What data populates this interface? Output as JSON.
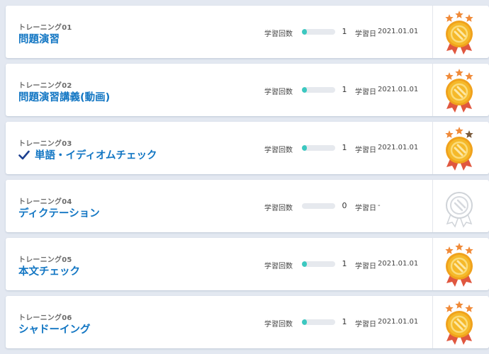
{
  "trainings": [
    {
      "label": "トレーニング01",
      "title": "問題演習",
      "checked": false,
      "count_label": "学習回数",
      "progress": 0.15,
      "count": "1",
      "date_label": "学習日",
      "date": "2021.01.01",
      "medal": "gold-medal-icon"
    },
    {
      "label": "トレーニング02",
      "title": "問題演習講義(動画)",
      "checked": false,
      "count_label": "学習回数",
      "progress": 0.15,
      "count": "1",
      "date_label": "学習日",
      "date": "2021.01.01",
      "medal": "gold-medal-icon"
    },
    {
      "label": "トレーニング03",
      "title": "単語・イディオムチェック",
      "checked": true,
      "count_label": "学習回数",
      "progress": 0.15,
      "count": "1",
      "date_label": "学習日",
      "date": "2021.01.01",
      "medal": "gold-medal-two-stars-icon"
    },
    {
      "label": "トレーニング04",
      "title": "ディクテーション",
      "checked": false,
      "count_label": "学習回数",
      "progress": 0,
      "count": "0",
      "date_label": "学習日",
      "date": "-",
      "medal": "empty-medal-icon"
    },
    {
      "label": "トレーニング05",
      "title": "本文チェック",
      "checked": false,
      "count_label": "学習回数",
      "progress": 0.15,
      "count": "1",
      "date_label": "学習日",
      "date": "2021.01.01",
      "medal": "gold-medal-icon"
    },
    {
      "label": "トレーニング06",
      "title": "シャドーイング",
      "checked": false,
      "count_label": "学習回数",
      "progress": 0.15,
      "count": "1",
      "date_label": "学習日",
      "date": "2021.01.01",
      "medal": "gold-medal-icon"
    }
  ],
  "colors": {
    "title": "#1276c3",
    "progress_fill": "#3cc8c0",
    "medal_gold": "#f5b92a",
    "medal_ribbon": "#e0573f",
    "star_active": "#f08a38",
    "star_inactive": "#7a5a3a"
  }
}
